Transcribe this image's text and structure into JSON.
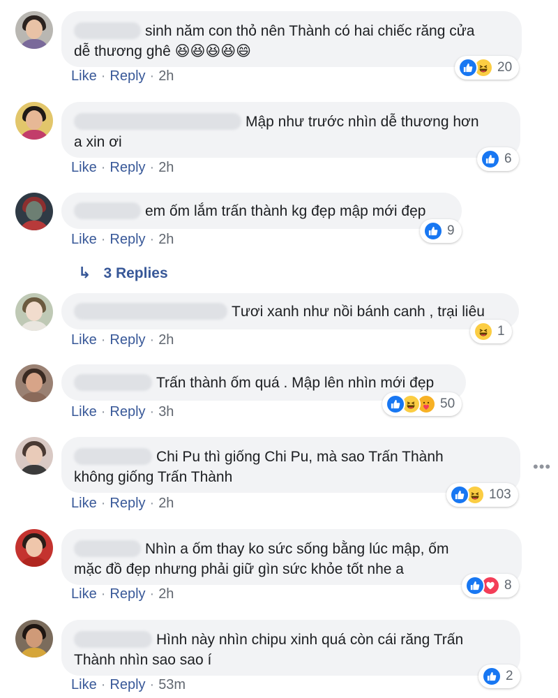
{
  "comments": [
    {
      "text": "sinh năm con thỏ nên Thành có hai chiếc răng cửa dễ thương ghê 😆😆😆😆😄",
      "lines": [
        "sinh năm con thỏ nên Thành có hai chiếc răng cửa",
        "dễ thương ghê 😆😆😆😆😄"
      ],
      "like_label": "Like",
      "reply_label": "Reply",
      "time": "2h",
      "reactions": [
        "like",
        "haha"
      ],
      "reaction_count": "20",
      "avatar_colors": {
        "bg": "#b9b7b2",
        "hair": "#2b2320",
        "face": "#e8c2a6",
        "body": "#7a6a9a"
      }
    },
    {
      "text": "Mập như trước nhìn dễ thương hơn a xin ơi",
      "lines": [
        "Mập như trước nhìn dễ thương hơn",
        "a xin ơi"
      ],
      "like_label": "Like",
      "reply_label": "Reply",
      "time": "2h",
      "reactions": [
        "like"
      ],
      "reaction_count": "6",
      "avatar_colors": {
        "bg": "#e2c66b",
        "hair": "#1f1a17",
        "face": "#e7b896",
        "body": "#c23d6a"
      }
    },
    {
      "text": "em ốm lắm trấn thành kg đẹp mập mới đẹp",
      "lines": [
        "em ốm lắm trấn thành kg đẹp mập mới đẹp"
      ],
      "like_label": "Like",
      "reply_label": "Reply",
      "time": "2h",
      "reactions": [
        "like"
      ],
      "reaction_count": "9",
      "avatar_colors": {
        "bg": "#2f3a45",
        "hair": "#8c2f2f",
        "face": "#6d7f73",
        "body": "#b73a3a"
      }
    },
    {
      "text": "Tươi xanh như nồi bánh canh , trại liêu",
      "lines": [
        "Tươi xanh như nồi bánh canh , trại liêu"
      ],
      "like_label": "Like",
      "reply_label": "Reply",
      "time": "2h",
      "reactions": [
        "haha"
      ],
      "reaction_count": "1",
      "avatar_colors": {
        "bg": "#bfc9b5",
        "hair": "#6b5a3f",
        "face": "#f1dccd",
        "body": "#e9e6df"
      }
    },
    {
      "text": "Trấn thành ốm quá . Mập lên nhìn mới đẹp",
      "lines": [
        "Trấn thành ốm quá . Mập lên nhìn mới đẹp"
      ],
      "like_label": "Like",
      "reply_label": "Reply",
      "time": "3h",
      "reactions": [
        "like",
        "haha",
        "care"
      ],
      "reaction_count": "50",
      "avatar_colors": {
        "bg": "#9a8173",
        "hair": "#3a2a22",
        "face": "#d7a488",
        "body": "#8a6a5a"
      }
    },
    {
      "text": "Chi Pu thì giống Chi Pu, mà sao Trấn Thành không giống Trấn Thành",
      "lines": [
        "Chi Pu thì giống Chi Pu, mà sao Trấn Thành",
        "không giống Trấn Thành"
      ],
      "like_label": "Like",
      "reply_label": "Reply",
      "time": "2h",
      "reactions": [
        "like",
        "haha"
      ],
      "reaction_count": "103",
      "avatar_colors": {
        "bg": "#d9c9c4",
        "hair": "#4a3a33",
        "face": "#e9cbb9",
        "body": "#3b3b3b"
      }
    },
    {
      "text": "Nhìn a ốm thay ko sức sống bằng lúc mập, ốm mặc đồ đẹp nhưng phải giữ gìn sức khỏe tốt nhe a",
      "lines": [
        "Nhìn a ốm thay ko sức sống bằng lúc mập, ốm",
        "mặc đồ đẹp nhưng phải giữ gìn sức khỏe tốt nhe a"
      ],
      "like_label": "Like",
      "reply_label": "Reply",
      "time": "2h",
      "reactions": [
        "like",
        "love"
      ],
      "reaction_count": "8",
      "avatar_colors": {
        "bg": "#c4332f",
        "hair": "#2a1d18",
        "face": "#efc6ab",
        "body": "#b0261f"
      }
    },
    {
      "text": "Hình này nhìn chipu xinh quá còn cái răng Trấn Thành nhìn sao sao í",
      "lines": [
        "Hình này nhìn chipu xinh quá còn cái răng Trấn",
        "Thành nhìn sao sao í"
      ],
      "like_label": "Like",
      "reply_label": "Reply",
      "time": "53m",
      "reactions": [
        "like"
      ],
      "reaction_count": "2",
      "avatar_colors": {
        "bg": "#7b6c5c",
        "hair": "#1e1612",
        "face": "#cf9a78",
        "body": "#d5a53a"
      }
    }
  ],
  "replies_link": {
    "label": "3 Replies"
  },
  "colors": {
    "link": "#385898",
    "bubble": "#f2f3f5",
    "like_blue": "#1877f2",
    "haha_yellow": "#fbcd43",
    "love_red": "#f33e58"
  }
}
